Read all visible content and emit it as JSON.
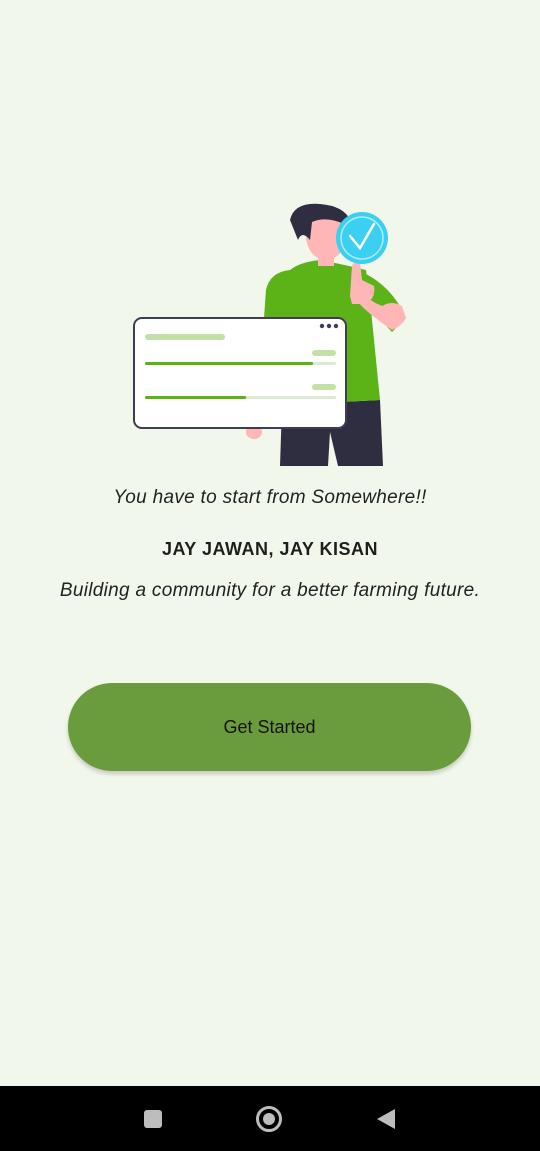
{
  "onboarding": {
    "tagline": "You have to start from Somewhere!!",
    "slogan": "JAY JAWAN, JAY KISAN",
    "subtitle": "Building a community for a better farming future.",
    "get_started_label": "Get Started"
  },
  "illustration": {
    "icon": "person-thumbs-up-checklist-illustration",
    "checkmark_icon": "checkmark-badge-icon",
    "progress_bars": [
      0.88,
      0.53
    ]
  },
  "colors": {
    "background": "#f1f7ea",
    "button": "#6a9b3d",
    "accent_green": "#5bb318",
    "check_blue": "#3bd0f2"
  },
  "system_nav": {
    "recents_icon": "square-icon",
    "home_icon": "circle-icon",
    "back_icon": "triangle-back-icon"
  }
}
